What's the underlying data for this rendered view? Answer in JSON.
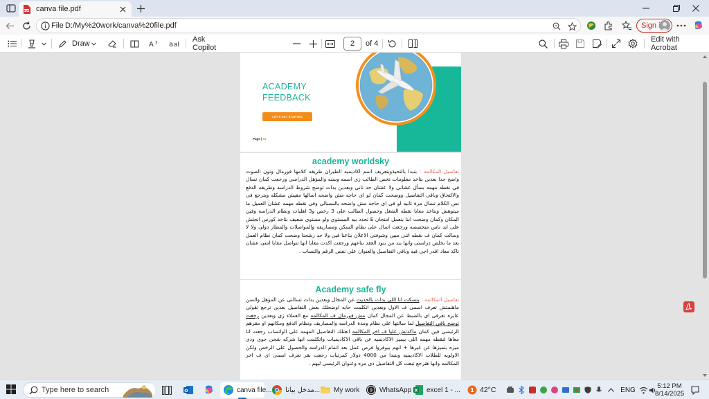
{
  "browser": {
    "tab": {
      "title": "canva file.pdf"
    },
    "address": {
      "scheme": "File",
      "url": "D:/My%20work/canva%20file.pdf"
    },
    "signin_label": "Sign in"
  },
  "pdf_toolbar": {
    "draw_label": "Draw",
    "copilot_label": "Ask Copilot",
    "current_page": "2",
    "page_count_label": "of 4",
    "edit_label": "Edit with Acrobat"
  },
  "pages": {
    "page1": {
      "title_line1": "ACADEMY",
      "title_line2": "FEEDBACK",
      "button_label": "LET'S GET STARTED",
      "page_label": "Page |",
      "page_num": "01"
    },
    "page2": {
      "heading": "academy worldsky",
      "label": "تفاصيل المكالمه :",
      "body": "بتبدا بالتحيةوبتعريف اسم اكاديميه الطيران طريقه كلامها فورمال وتون الصوت واضح جدا بعدين بتاخد معلومات تخص الطالب زى اسمه وسنه والمؤهل الدراسي ورجعت كمان تسال فى نقطه مهمه بسأل عشانى ولا عشان حد تانى وبعدين بدات توضح شروط الدراسه وطريقه الدفع والالتحاق وباقى التفاصيل ووضحت كمان لو اى حاجه مش واضحه اسالها مفيش مشكله وبترجع فى نص الكلام تسال مرة تانيه لو فى اى حاجه مش واضحه بالنسبالى وفى نقطه مهمه عشان العميل ما ميتوهش وبتاخد معايا نقطه الشغل وحصول الطالب على 3 رخص و3 اهليات ونظام الدراسه وفين المكان وكمان وضحت اننا بنعمل امتحان E تحدد بيه المستوى ولو مستوى ضعيف بتاخد كورس انجلش على ايد ناس متخصصه ورجعت اسال على نظام السكن ومصاريفه والمواصلات والمطار دولى ولا لا وسالت كمان ف نقطه اتنى مبين وشوفتى الاعلان بتاعنا فين ولا حد رشحنا وضحت كمان نظام العمل بعد ما بخلص دراستى وانها بند من بنود العقد بتاعهم ورجعت اكدت معايا انها تتواصل معايا امتى عشان تاكد معاد اقدر اجى فيه وباقى التفاصيل والعنوان على نفس الرقم والتساب ."
    },
    "page3": {
      "heading": "Academy safe fly",
      "label": "تفاصيل المكالمه :",
      "underlined_1": "بتسكت انا اللى بدات بالحديث",
      "body_1": "عن المجال وبعدين بدات تسالنى عن المؤهل والسن ماهتمتش تعرف اسمى ف الاول وبعدين اتكلمت حابه اوضحلك بعض التفاصيل بعدين ترجع تقولى عايزه تعرفى اى بالضبط عن المجال كمان",
      "underlined_2": "مش فورمال ف المكالمه",
      "body_2": "مع العملاء زى وبعدين",
      "underlined_3": "رجعت توضح باقى التفاصيل",
      "body_3": "لما سالتها على نظام ومدة الدراسه والمصاريف ونظام الدفع ومكانهم او مقرهم الرئيسى فين كمان",
      "underlined_4": "ماكدتش عليا ف اخر المكالمه",
      "body_4": "انعتلك التفاصيل المهمه على الواتساب رجعت انا معاها لنقطه مهمه اللى بيميز الاكاديميه عن باقى الاكاديميات واتكلمت انها شركه شحن جوى ودى ميزه بتميزها عن غيرها + انهم بيوفروا فرص عمل بعد اتمام الدراسه والحصول على الرخص ولكن الاولويه للطلاب الاكاديميه وبتبدا من 4000 دولار كمرتبات رجعت بقر تعرف اسمى اى ف اخر المكالمه وانها هترجع تبعت كل التفاصيل دى مره وعنوان الرئيسى ليهم ."
    }
  },
  "taskbar": {
    "search_placeholder": "Type here to search",
    "apps": [
      {
        "label": "canva file...."
      },
      {
        "label": "مدخل بيانا..."
      },
      {
        "label": "My work"
      },
      {
        "label": "WhatsApp",
        "badge": "9"
      },
      {
        "label": "excel 1 - ..."
      }
    ],
    "weather": {
      "badge": "1",
      "temp": "42°C"
    },
    "language": "ENG",
    "time": "5:12 PM",
    "date": "8/14/2025"
  },
  "colors": {
    "accent_teal": "#19b69a",
    "accent_orange": "#f48c1a",
    "signin_red": "#c42b1c"
  }
}
